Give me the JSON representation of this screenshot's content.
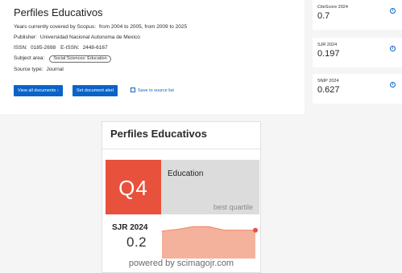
{
  "source": {
    "title": "Perfiles Educativos",
    "coverage_label": "Years currently covered by Scopus:",
    "coverage_value": "from 2004 to 2005, from 2009 to 2025",
    "publisher_label": "Publisher:",
    "publisher_value": "Universidad Nacional Autonoma de Mexico",
    "issn_label": "ISSN:",
    "issn_value": "0185-2698",
    "eissn_label": "E-ISSN:",
    "eissn_value": "2448-6167",
    "subject_label": "Subject area:",
    "subject_chip": "Social Sciences: Education",
    "type_label": "Source type:",
    "type_value": "Journal",
    "buttons": {
      "view_all": "View all documents ›",
      "set_alert": "Set document alert",
      "save": "Save to source list"
    }
  },
  "metrics": [
    {
      "label": "CiteScore 2024",
      "value": "0.7"
    },
    {
      "label": "SJR 2024",
      "value": "0.197"
    },
    {
      "label": "SNIP 2024",
      "value": "0.627"
    }
  ],
  "widget": {
    "title": "Perfiles Educativos",
    "quartile": "Q4",
    "category": "Education",
    "quartile_caption": "best quartile",
    "sjr_label": "SJR 2024",
    "sjr_value": "0.2",
    "powered_by": "powered by scimagojr.com",
    "colors": {
      "quartile": "#e8513b",
      "spark_fill": "#f4b29c",
      "spark_line": "#f08d6e",
      "spark_end": "#e8513b"
    },
    "sparkline_trend": [
      0.19,
      0.21,
      0.24,
      0.24,
      0.2,
      0.2,
      0.2
    ]
  }
}
